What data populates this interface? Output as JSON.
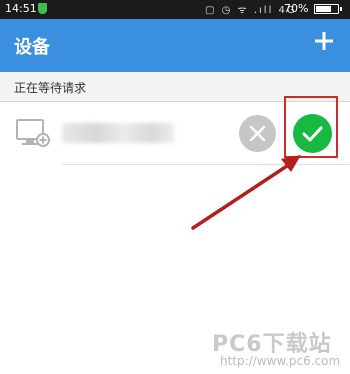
{
  "status_bar": {
    "time": "14:51",
    "system_icons": "▢ ◷ ᯤ .ıll 4G",
    "battery_percent": 70,
    "battery_label": "70%"
  },
  "app_bar": {
    "title": "设备",
    "add_icon": "plus-icon"
  },
  "section": {
    "label": "正在等待请求"
  },
  "device_request": {
    "device_icon": "monitor-add-icon",
    "reject_icon": "close-icon",
    "accept_icon": "checkmark-icon"
  },
  "annotation": {
    "box_color": "#d22a25",
    "arrow_color": "#b3201b"
  },
  "watermark": {
    "brand": "PC6下载站",
    "url": "http://www.pc6.com"
  },
  "colors": {
    "app_bar": "#3b8fdf",
    "accept": "#17b940",
    "reject": "#c6c6c6"
  }
}
